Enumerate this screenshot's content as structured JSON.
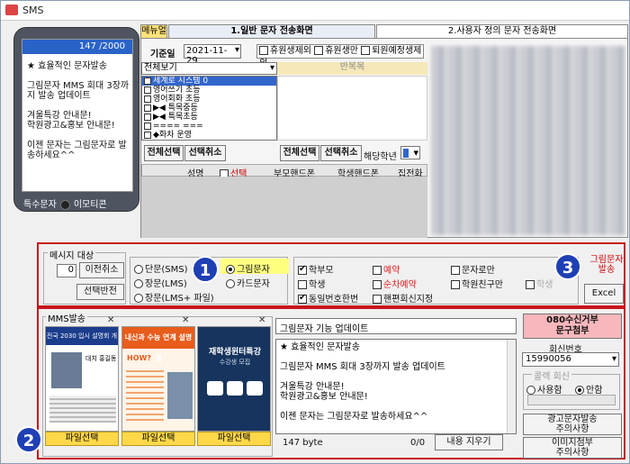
{
  "window": {
    "title": "SMS"
  },
  "phone": {
    "counter": "147 /2000",
    "message": "★ 효율적인 문자발송\n\n그림문자 MMS 회대 3장까지 발송 업데이트\n\n겨울특강 안내문!\n학원광고&홍보 안내문!\n\n이젠 문자는 그림문자로 발송하세요^^",
    "special_chars": "특수문자",
    "emoticon": "이모티콘"
  },
  "tabs": {
    "menu": "메뉴얼",
    "tab1": "1.일반 문자 전송화면",
    "tab2": "2.사용자 정의 문자 전송화면"
  },
  "filters": {
    "date_label": "기준일",
    "date_value": "2021-11-29",
    "opt1": "휴원생제외",
    "opt2": "휴원생만",
    "opt3": "퇴원예정생제외",
    "view": "전체보기",
    "recurring": "반복목"
  },
  "class_list": [
    "세계로 시스템 0",
    "영어쓰기 초등",
    "영어회화 초등",
    "▶◀ 특목중등",
    "▶◀ 특목초등",
    "==== ===",
    "◆화차 운영"
  ],
  "list_buttons": {
    "select_all": "전체선택",
    "deselect": "선택취소",
    "select_all2": "전체선택",
    "deselect2": "선택취소",
    "grade_label": "해당학년"
  },
  "table_headers": [
    "성명",
    "선택",
    "부모핸드폰",
    "학생핸드폰",
    "집전화"
  ],
  "target": {
    "legend": "메시지 대상",
    "count": "0",
    "cancel_prev": "이전취소",
    "invert": "선택반전"
  },
  "msg_type": {
    "short": "단문(SMS)",
    "picture": "그림문자",
    "long": "장문(LMS)",
    "card": "카드문자",
    "long_file": "장문(LMS+ 파일)"
  },
  "recipients": {
    "parent": "학부모",
    "student": "학생",
    "same_number": "동일번호한번",
    "reserve": "예약",
    "sequential": "순차예약",
    "phone_reply": "핸편회신지정",
    "text_only": "문자로만",
    "friend_only": "학원친구만",
    "student_dim": "학생",
    "picture_send": "그림문자 발송",
    "excel": "Excel"
  },
  "mms": {
    "legend": "MMS발송",
    "thumbs": [
      {
        "head": "전국 2030 입시 설명회 개최",
        "sub": "대치 홍길동"
      },
      {
        "head": "내신과 수능 연계 설명회",
        "sub": "HOW?"
      },
      {
        "head": "재학생윈터특강",
        "sub": "수강생 모집"
      }
    ],
    "file_select": "파일선택"
  },
  "compose": {
    "subject": "그림문자 기능 업데이트",
    "body": "★ 효율적인 문자발송\n\n그림문자 MMS 회대 3장까지 발송 업데이트\n\n겨울특강 안내문!\n학원광고&홍보 안내문!\n\n이젠 문자는 그림문자로 발송하세요^^",
    "bytes": "147 byte",
    "ratio": "0/0",
    "clear": "내용 지우기"
  },
  "side": {
    "reject": "080수신거부\n문구첨부",
    "callback_label": "회신번호",
    "callback_value": "15990056",
    "collect_legend": "콜렉 회신",
    "use": "사용함",
    "nouse": "안함",
    "ad_notice": "광고문자발송\n주의사항",
    "img_notice": "이미지첨부\n주의사항"
  },
  "badges": [
    "1",
    "2",
    "3"
  ]
}
